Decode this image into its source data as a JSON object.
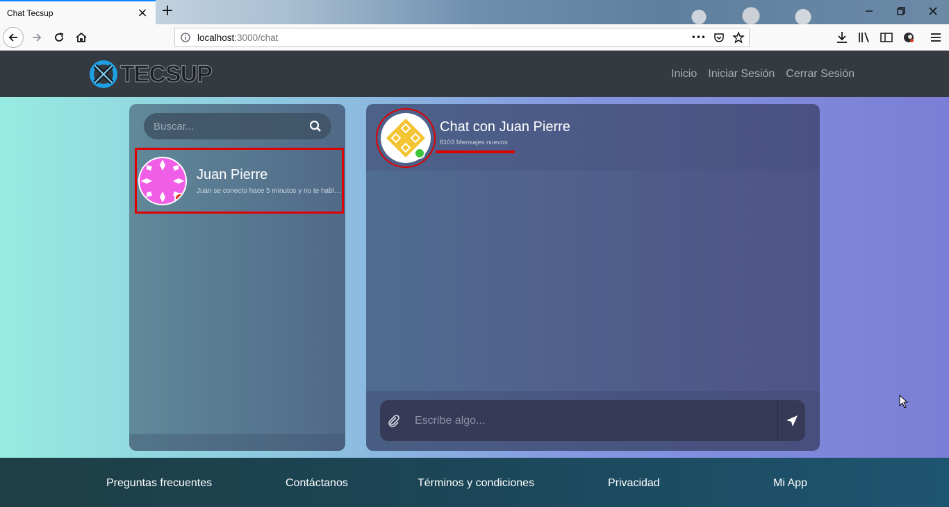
{
  "browser": {
    "tab_title": "Chat Tecsup",
    "tab_close": "×",
    "new_tab": "+",
    "url_host": "localhost",
    "url_rest": ":3000/chat",
    "page_actions": "•••"
  },
  "header": {
    "logo_text": "TECSUP",
    "nav": [
      "Inicio",
      "Iniciar Sesión",
      "Cerrar Sesión"
    ]
  },
  "sidebar": {
    "search_placeholder": "Buscar...",
    "contacts": [
      {
        "name": "Juan Pierre",
        "last_message": "Juan se conecto hace 5 minutos y no te habló...",
        "status_color": "#d43a1a",
        "avatar_color": "#f05ee8"
      }
    ]
  },
  "chat": {
    "title": "Chat con Juan Pierre",
    "subtitle": "8103 Mensajes nuevos",
    "status_color": "#3cc43c",
    "avatar_color": "#f4c430",
    "composer_placeholder": "Escribe algo..."
  },
  "footer": {
    "links": [
      "Preguntas frecuentes",
      "Contáctanos",
      "Términos y condiciones",
      "Privacidad",
      "Mi App"
    ]
  },
  "colors": {
    "highlight": "#e10000",
    "header_bg": "#343a40",
    "accent": "#1da1e4"
  }
}
